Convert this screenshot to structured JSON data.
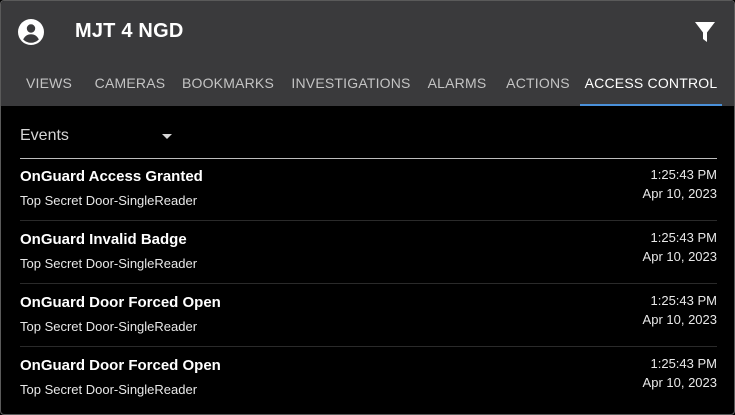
{
  "header": {
    "title": "MJT 4 NGD",
    "account_icon": "account-circle-icon",
    "filter_icon": "filter-icon"
  },
  "tabs": [
    {
      "label": "VIEWS",
      "active": false
    },
    {
      "label": "CAMERAS",
      "active": false
    },
    {
      "label": "BOOKMARKS",
      "active": false
    },
    {
      "label": "INVESTIGATIONS",
      "active": false
    },
    {
      "label": "ALARMS",
      "active": false
    },
    {
      "label": "ACTIONS",
      "active": false
    },
    {
      "label": "ACCESS CONTROL",
      "active": true
    }
  ],
  "filter_select": {
    "value": "Events"
  },
  "events": [
    {
      "title": "OnGuard Access Granted",
      "subtitle": "Top Secret Door-SingleReader",
      "time": "1:25:43 PM",
      "date": "Apr 10, 2023"
    },
    {
      "title": "OnGuard Invalid Badge",
      "subtitle": "Top Secret Door-SingleReader",
      "time": "1:25:43 PM",
      "date": "Apr 10, 2023"
    },
    {
      "title": "OnGuard Door Forced Open",
      "subtitle": "Top Secret Door-SingleReader",
      "time": "1:25:43 PM",
      "date": "Apr 10, 2023"
    },
    {
      "title": "OnGuard Door Forced Open",
      "subtitle": "Top Secret Door-SingleReader",
      "time": "1:25:43 PM",
      "date": "Apr 10, 2023"
    }
  ],
  "colors": {
    "appbar": "#3a3a3c",
    "accent": "#4a90d9",
    "background": "#000000"
  }
}
